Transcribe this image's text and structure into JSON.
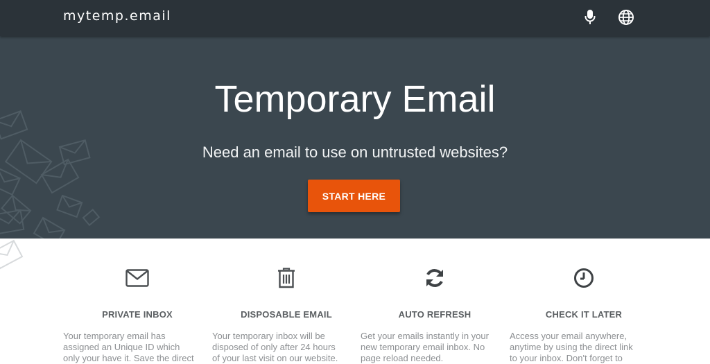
{
  "header": {
    "brand": "mytemp.email",
    "mic_icon": "microphone-icon",
    "globe_icon": "globe-icon"
  },
  "hero": {
    "title": "Temporary Email",
    "subtitle": "Need an email to use on untrusted websites?",
    "cta_label": "START HERE",
    "background_color": "#3b474f",
    "cta_color": "#e8540b"
  },
  "features": [
    {
      "icon": "envelope-icon",
      "title": "PRIVATE INBOX",
      "lines": [
        "Your temporary email has",
        "assigned an Unique ID which",
        "only your have it. Save the direct"
      ]
    },
    {
      "icon": "trash-icon",
      "title": "DISPOSABLE EMAIL",
      "lines": [
        "Your temporary inbox will be",
        "disposed of only after 24 hours",
        "of your last visit on our website."
      ]
    },
    {
      "icon": "refresh-icon",
      "title": "AUTO REFRESH",
      "lines": [
        "Get your emails instantly in your",
        "new temporary email inbox. No",
        "page reload needed."
      ]
    },
    {
      "icon": "clock-icon",
      "title": "CHECK IT LATER",
      "lines": [
        "Access your email anywhere,",
        "anytime by using the direct link",
        "to your inbox. Don't forget to"
      ]
    }
  ]
}
